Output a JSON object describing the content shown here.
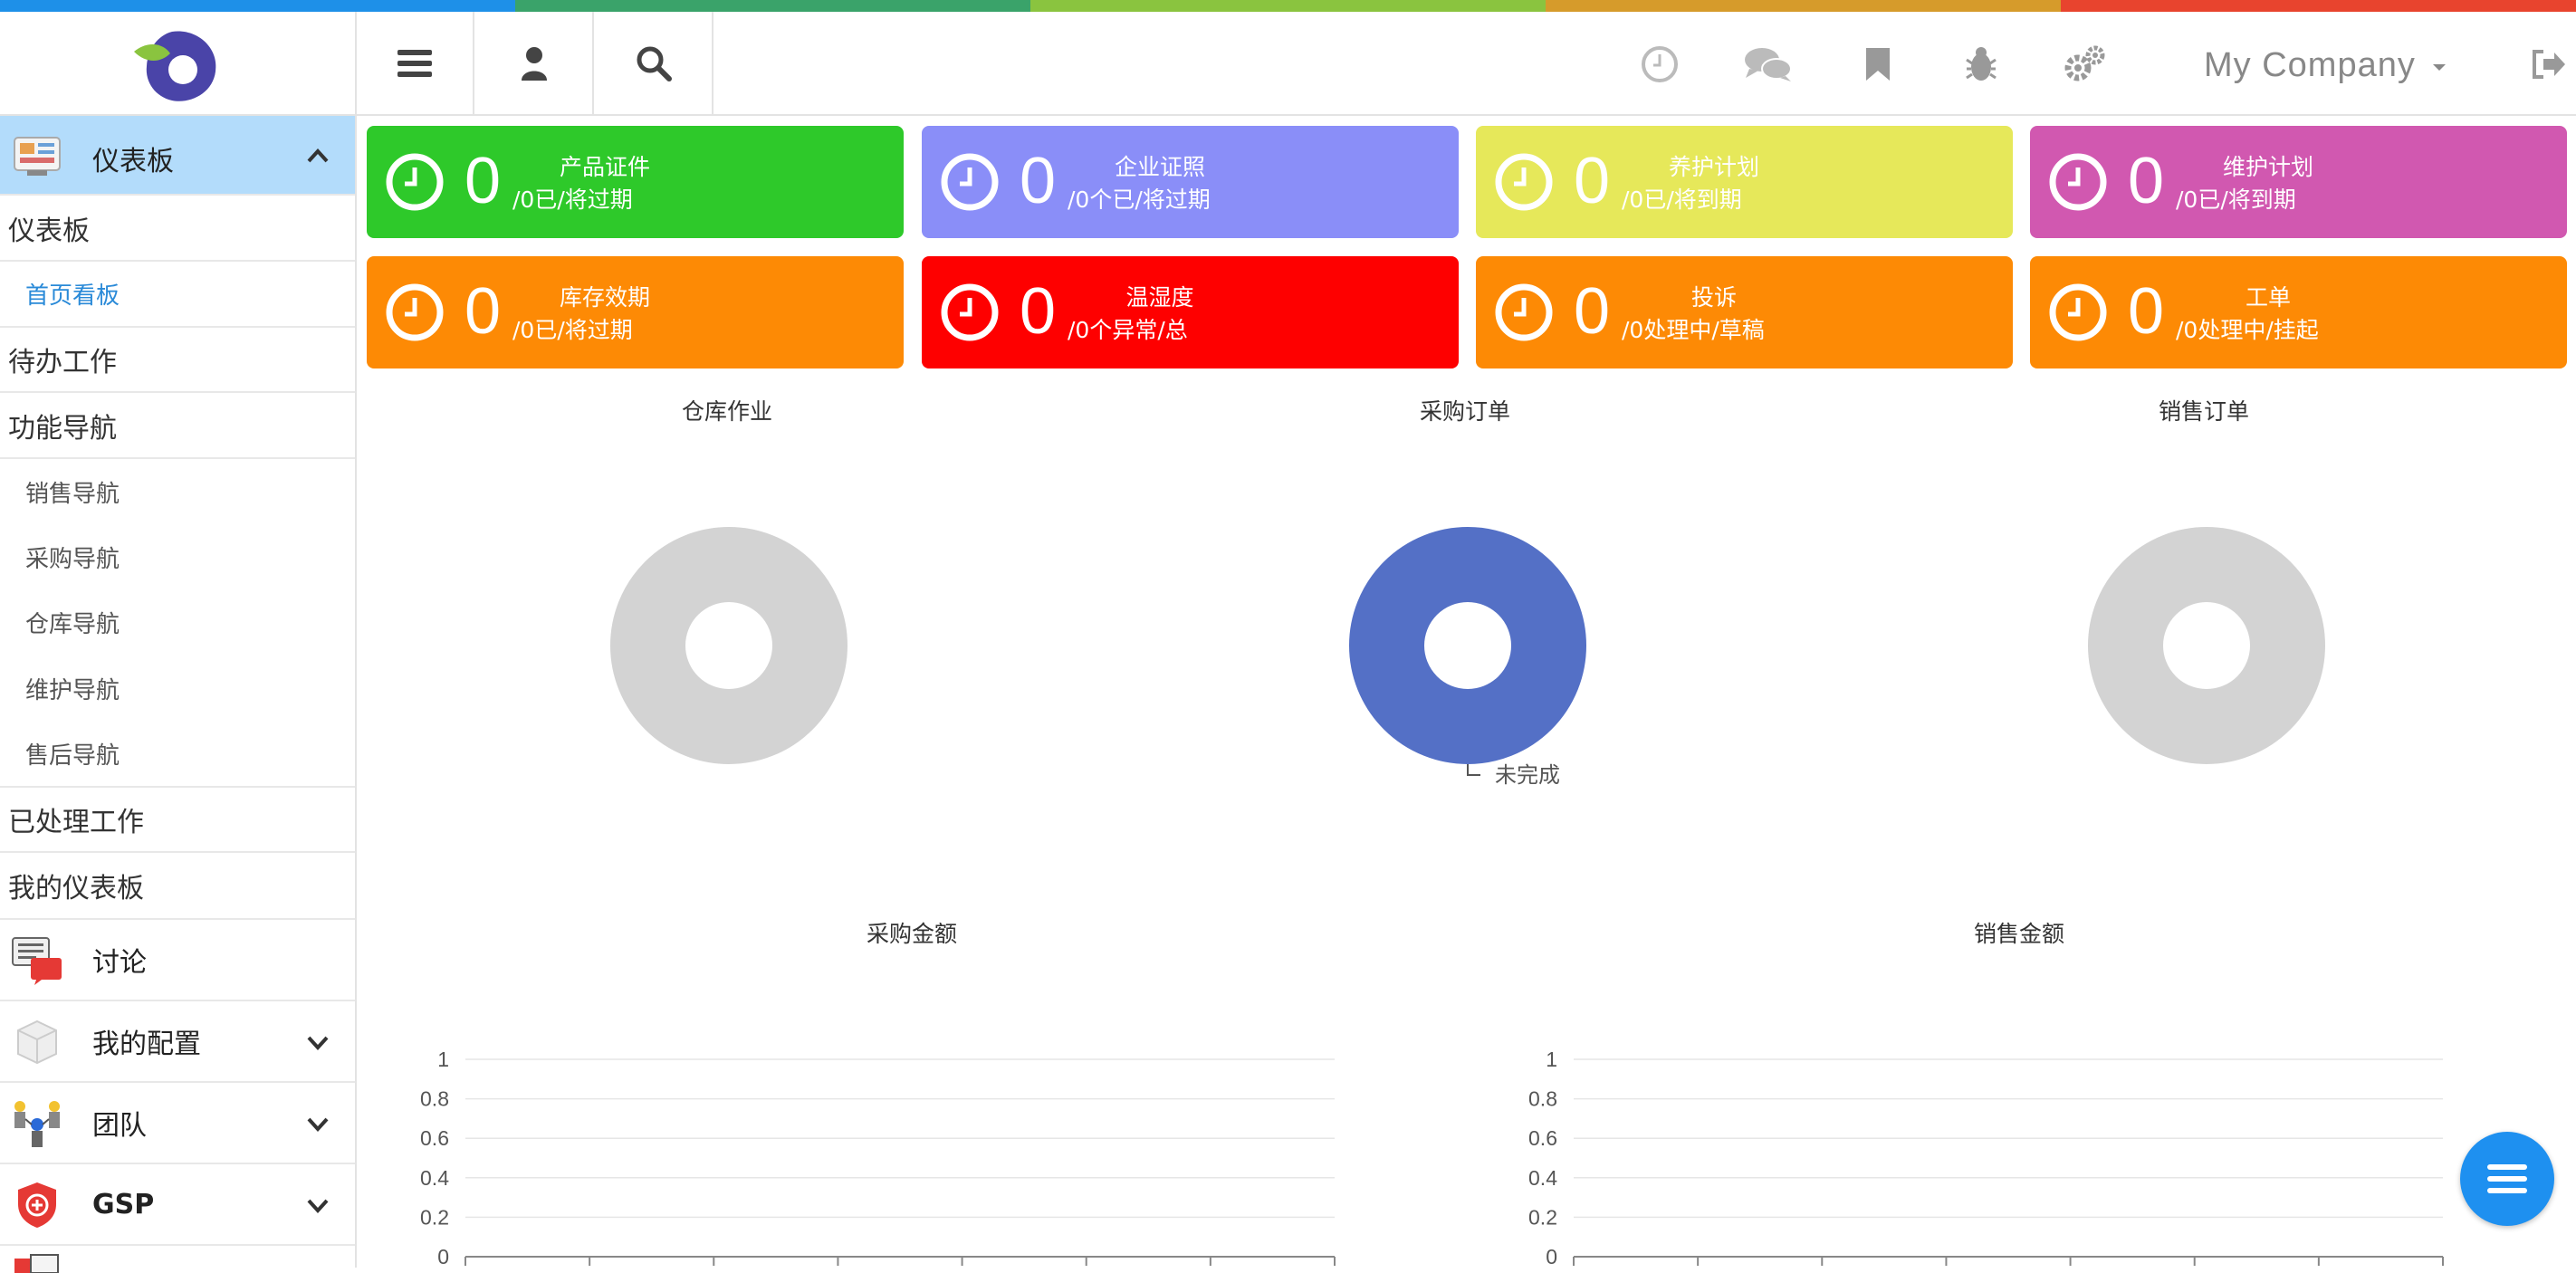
{
  "colors": {
    "topbar": [
      "#1e90e8",
      "#3aa36a",
      "#8ac43f",
      "#d69b2b",
      "#e8442e"
    ],
    "sidebar_active_bg": "#b3dcfb",
    "link_blue": "#2a8ad8",
    "donut_gray": "#d3d3d3",
    "donut_blue": "#5470c6",
    "fab_blue": "#1e90f0"
  },
  "header": {
    "company": "My Company",
    "left_buttons": [
      "menu-icon",
      "user-icon",
      "search-icon"
    ],
    "right_icons": [
      "clock-icon",
      "chat-icon",
      "bookmark-icon",
      "bug-icon",
      "gears-icon",
      "logout-icon"
    ]
  },
  "sidebar": {
    "active_section": "仪表板",
    "items": [
      {
        "label": "仪表板"
      },
      {
        "label": "首页看板"
      },
      {
        "label": "待办工作"
      },
      {
        "label": "功能导航"
      },
      {
        "label": "销售导航"
      },
      {
        "label": "采购导航"
      },
      {
        "label": "仓库导航"
      },
      {
        "label": "维护导航"
      },
      {
        "label": "售后导航"
      },
      {
        "label": "已处理工作"
      },
      {
        "label": "我的仪表板"
      }
    ],
    "sections": [
      {
        "label": "讨论"
      },
      {
        "label": "我的配置"
      },
      {
        "label": "团队"
      },
      {
        "label": "GSP"
      }
    ]
  },
  "cards": [
    {
      "title": "产品证件",
      "value": "0",
      "sub": "/0已/将过期",
      "color": "#2ec92a"
    },
    {
      "title": "企业证照",
      "value": "0",
      "sub": "/0个已/将过期",
      "color": "#8a8ef8"
    },
    {
      "title": "养护计划",
      "value": "0",
      "sub": "/0已/将到期",
      "color": "#e6e85a"
    },
    {
      "title": "维护计划",
      "value": "0",
      "sub": "/0已/将到期",
      "color": "#d158b0"
    },
    {
      "title": "库存效期",
      "value": "0",
      "sub": "/0已/将过期",
      "color": "#fd8a05"
    },
    {
      "title": "温湿度",
      "value": "0",
      "sub": "/0个异常/总",
      "color": "#fe0000"
    },
    {
      "title": "投诉",
      "value": "0",
      "sub": "/0处理中/草稿",
      "color": "#fd8a05"
    },
    {
      "title": "工单",
      "value": "0",
      "sub": "/0处理中/挂起",
      "color": "#fd8a05"
    }
  ],
  "chart_data": [
    {
      "type": "pie",
      "title": "仓库作业",
      "slices": [],
      "style": "donut",
      "empty": true
    },
    {
      "type": "pie",
      "title": "采购订单",
      "slices": [
        {
          "label": "未完成",
          "value": 1
        }
      ],
      "style": "donut"
    },
    {
      "type": "pie",
      "title": "销售订单",
      "slices": [],
      "style": "donut",
      "empty": true
    },
    {
      "type": "bar",
      "title": "采购金额",
      "categories": [
        "",
        "",
        "",
        "",
        "",
        "",
        ""
      ],
      "values": [
        0,
        0,
        0,
        0,
        0,
        0,
        0
      ],
      "ylim": [
        0,
        1
      ],
      "yticks": [
        "0",
        "0.2",
        "0.4",
        "0.6",
        "0.8",
        "1"
      ],
      "grid": true
    },
    {
      "type": "bar",
      "title": "销售金额",
      "categories": [
        "",
        "",
        "",
        "",
        "",
        "",
        ""
      ],
      "values": [
        0,
        0,
        0,
        0,
        0,
        0,
        0
      ],
      "ylim": [
        0,
        1
      ],
      "yticks": [
        "0",
        "0.2",
        "0.4",
        "0.6",
        "0.8",
        "1"
      ],
      "grid": true
    }
  ],
  "fab": {
    "icon": "menu-icon"
  }
}
